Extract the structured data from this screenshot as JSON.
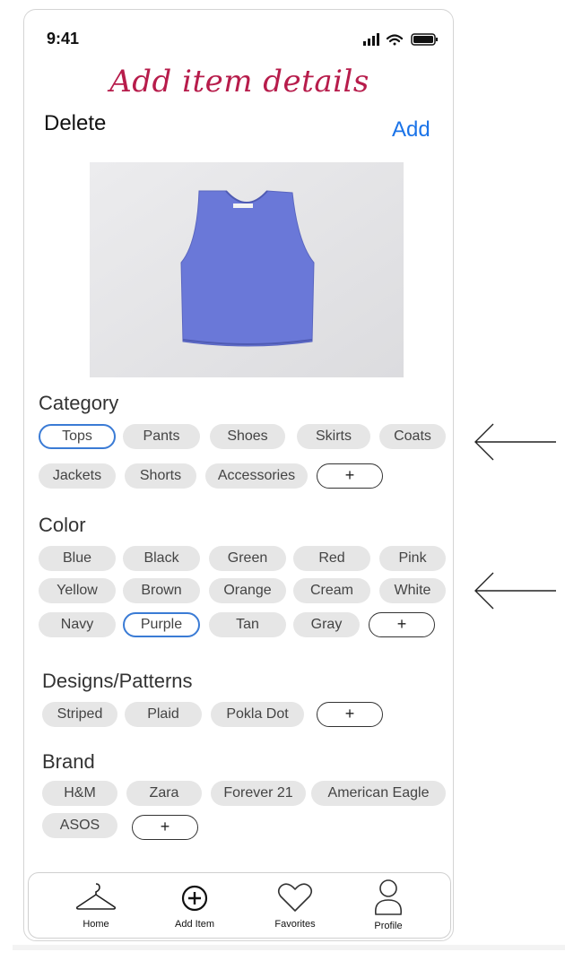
{
  "status": {
    "time": "9:41"
  },
  "header": {
    "title": "Add item details",
    "delete_label": "Delete",
    "add_label": "Add"
  },
  "sections": {
    "category": {
      "label": "Category",
      "chips": [
        {
          "label": "Tops",
          "selected": true
        },
        {
          "label": "Pants"
        },
        {
          "label": "Shoes"
        },
        {
          "label": "Skirts"
        },
        {
          "label": "Coats"
        },
        {
          "label": "Jackets"
        },
        {
          "label": "Shorts"
        },
        {
          "label": "Accessories"
        }
      ],
      "add_label": "+"
    },
    "color": {
      "label": "Color",
      "chips": [
        {
          "label": "Blue"
        },
        {
          "label": "Black"
        },
        {
          "label": "Green"
        },
        {
          "label": "Red"
        },
        {
          "label": "Pink"
        },
        {
          "label": "Yellow"
        },
        {
          "label": "Brown"
        },
        {
          "label": "Orange"
        },
        {
          "label": "Cream"
        },
        {
          "label": "White"
        },
        {
          "label": "Navy"
        },
        {
          "label": "Purple",
          "selected": true
        },
        {
          "label": "Tan"
        },
        {
          "label": "Gray"
        }
      ],
      "add_label": "+"
    },
    "patterns": {
      "label": "Designs/Patterns",
      "chips": [
        {
          "label": "Striped"
        },
        {
          "label": "Plaid"
        },
        {
          "label": "Pokla Dot"
        }
      ],
      "add_label": "+"
    },
    "brand": {
      "label": "Brand",
      "chips": [
        {
          "label": "H&M"
        },
        {
          "label": "Zara"
        },
        {
          "label": "Forever 21"
        },
        {
          "label": "American Eagle"
        },
        {
          "label": "ASOS"
        }
      ],
      "add_label": "+"
    }
  },
  "nav": [
    {
      "label": "Home",
      "icon": "hanger-icon"
    },
    {
      "label": "Add Item",
      "icon": "plus-circle-icon"
    },
    {
      "label": "Favorites",
      "icon": "heart-icon"
    },
    {
      "label": "Profile",
      "icon": "person-icon"
    }
  ],
  "colors": {
    "title": "#b71c4b",
    "add": "#1a73e8",
    "selected_border": "#3a7bd5",
    "chip_bg": "#e6e6e6",
    "tank_top": "#6a78d8"
  }
}
